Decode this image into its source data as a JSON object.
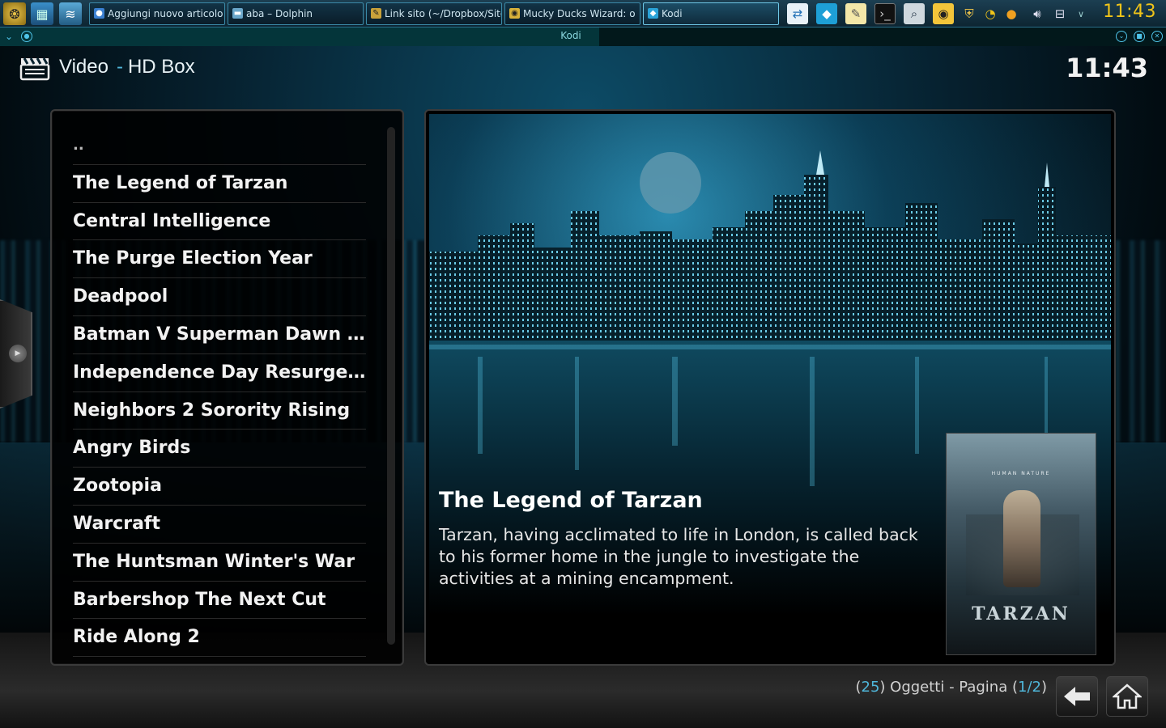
{
  "taskbar": {
    "tasks": [
      {
        "label": "Aggiungi nuovo articolo"
      },
      {
        "label": "aba – Dolphin"
      },
      {
        "label": "Link sito (~/Dropbox/Sito"
      },
      {
        "label": "Mucky Ducks Wizard: o"
      },
      {
        "label": "Kodi"
      }
    ],
    "clock": "11:43"
  },
  "window": {
    "title": "Kodi"
  },
  "header": {
    "section": "Video",
    "separator": "-",
    "source": "HD Box",
    "clock": "11:43"
  },
  "list": {
    "items": [
      "..",
      "The Legend of Tarzan",
      "Central Intelligence",
      "The Purge Election Year",
      "Deadpool",
      "Batman V Superman Dawn Of ...",
      "Independence Day Resurgence",
      "Neighbors 2 Sorority Rising",
      "Angry Birds",
      "Zootopia",
      "Warcraft",
      "The Huntsman Winter's War",
      "Barbershop The Next Cut",
      "Ride Along 2"
    ]
  },
  "selected": {
    "title": "The Legend of Tarzan",
    "plot": "Tarzan, having acclimated to life in London, is called back to his former home in the jungle to investigate the activities at a mining encampment.",
    "poster_title": "TARZAN",
    "poster_tagline": "HUMAN NATURE"
  },
  "footer": {
    "count": "25",
    "count_label": "Oggetti - Pagina",
    "page": "1/2"
  },
  "colors": {
    "accent": "#4fb6d9",
    "clock": "#f0c419"
  }
}
